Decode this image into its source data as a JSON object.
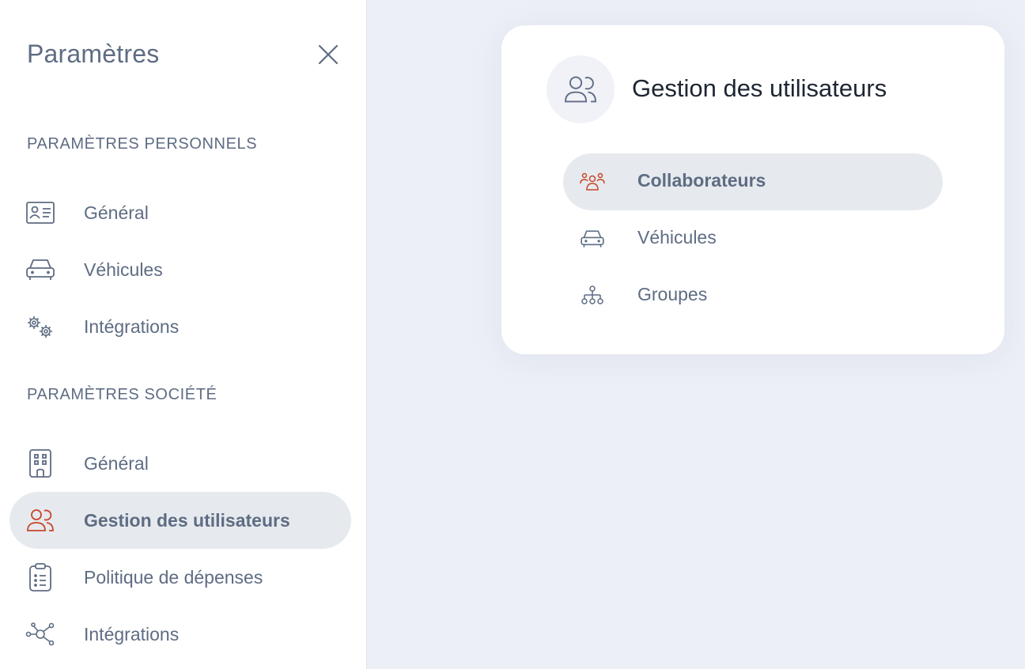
{
  "sidebar": {
    "title": "Paramètres",
    "personal_heading": "PARAMÈTRES PERSONNELS",
    "company_heading": "PARAMÈTRES SOCIÉTÉ",
    "personal_items": [
      {
        "label": "Général",
        "icon": "id-card-icon"
      },
      {
        "label": "Véhicules",
        "icon": "car-icon"
      },
      {
        "label": "Intégrations",
        "icon": "gears-icon"
      }
    ],
    "company_items": [
      {
        "label": "Général",
        "icon": "building-icon"
      },
      {
        "label": "Gestion des utilisateurs",
        "icon": "users-icon",
        "active": true
      },
      {
        "label": "Politique de dépenses",
        "icon": "clipboard-icon"
      },
      {
        "label": "Intégrations",
        "icon": "network-icon"
      }
    ]
  },
  "card": {
    "title": "Gestion des utilisateurs",
    "items": [
      {
        "label": "Collaborateurs",
        "icon": "team-icon",
        "active": true
      },
      {
        "label": "Véhicules",
        "icon": "car-icon"
      },
      {
        "label": "Groupes",
        "icon": "org-chart-icon"
      }
    ]
  },
  "colors": {
    "text": "#5e6c83",
    "accent": "#c8452c",
    "active_bg": "#e6eaee",
    "canvas": "#eceff6"
  }
}
